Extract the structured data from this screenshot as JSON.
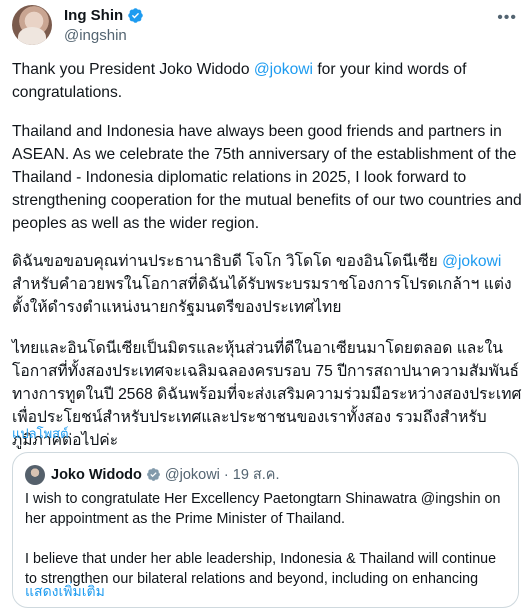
{
  "author": {
    "display_name": "Ing Shin",
    "handle": "@ingshin",
    "verified_icon": "verified-badge",
    "more_icon": "more-horizontal"
  },
  "tweet": {
    "p1_a": "Thank you President Joko Widodo ",
    "p1_mention": "@jokowi",
    "p1_b": " for your kind words of congratulations.",
    "p2": "Thailand and Indonesia have always been good friends and partners in ASEAN. As we celebrate the 75th anniversary of the establishment of the Thailand - Indonesia diplomatic relations in 2025, I look forward to strengthening cooperation for the mutual benefits of our two countries and peoples as well as the wider region.",
    "p3_a": "ดิฉันขอขอบคุณท่านประธานาธิบดี โจโก วิโดโด ของอินโดนีเซีย ",
    "p3_mention": "@jokowi",
    "p3_b": " สำหรับคำอวยพรในโอกาสที่ดิฉันได้รับพระบรมราชโองการโปรดเกล้าฯ แต่งตั้งให้ดำรงตำแหน่งนายกรัฐมนตรีของประเทศไทย",
    "p4": "ไทยและอินโดนีเซียเป็นมิตรและหุ้นส่วนที่ดีในอาเซียนมาโดยตลอด และในโอกาสที่ทั้งสองประเทศจะเฉลิมฉลองครบรอบ 75 ปีการสถาปนาความสัมพันธ์ทางการทูตในปี 2568 ดิฉันพร้อมที่จะส่งเสริมความร่วมมือระหว่างสองประเทศเพื่อประโยชน์สำหรับประเทศและประชาชนของเราทั้งสอง รวมถึงสำหรับภูมิภาคต่อไปค่ะ",
    "translate_label": "แปลโพสต์"
  },
  "quote": {
    "display_name": "Joko Widodo",
    "handle": "@jokowi",
    "separator": "·",
    "date": "19 ส.ค.",
    "text1": "I wish to congratulate Her Excellency Paetongtarn Shinawatra @ingshin on her appointment as the Prime Minister of Thailand.",
    "text2": "I believe that under her able leadership, Indonesia & Thailand will continue to strengthen our bilateral relations and beyond, including on enhancing",
    "show_more": "แสดงเพิ่มเติม"
  },
  "colors": {
    "accent": "#1d9bf0",
    "text": "#0f1419",
    "muted": "#536471",
    "border": "#cfd9de"
  }
}
